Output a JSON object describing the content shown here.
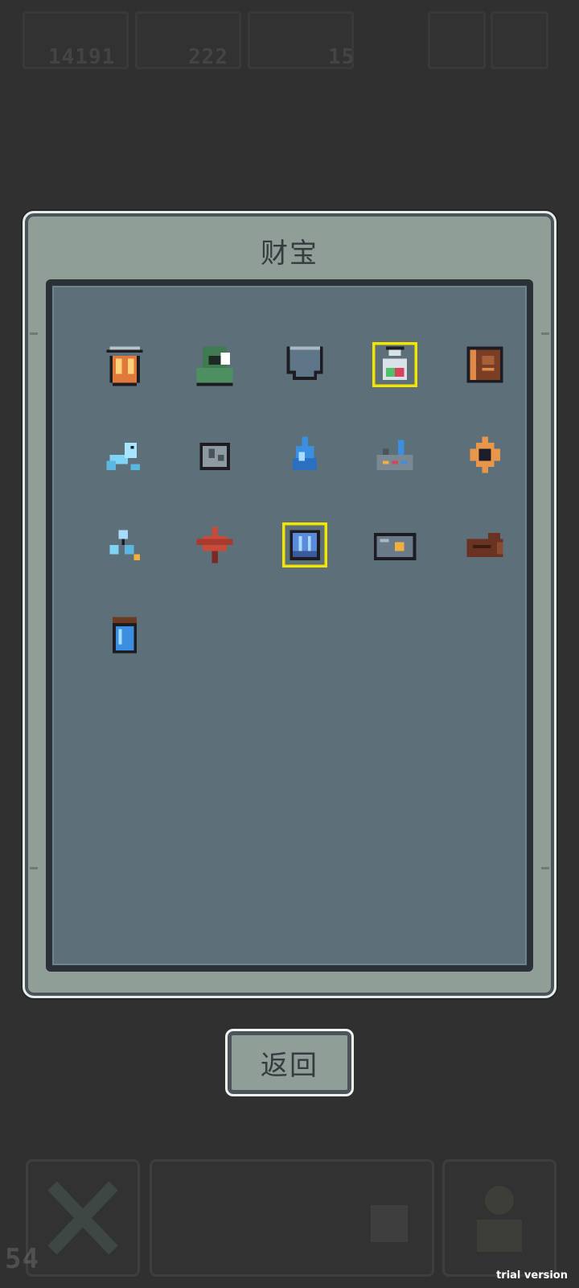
{
  "hud": {
    "currency_1": "14191",
    "currency_2": "222",
    "currency_3": "15",
    "level_readout": "54"
  },
  "panel": {
    "title": "财宝"
  },
  "items": [
    {
      "icon": "lantern-cup-icon"
    },
    {
      "icon": "green-hood-icon"
    },
    {
      "icon": "shield-pocket-icon"
    },
    {
      "icon": "potion-flask-icon"
    },
    {
      "icon": "brown-tome-icon"
    },
    {
      "icon": "ice-dragon-icon"
    },
    {
      "icon": "stone-ore-icon"
    },
    {
      "icon": "water-drop-icon"
    },
    {
      "icon": "factory-icon"
    },
    {
      "icon": "dark-diamond-icon"
    },
    {
      "icon": "blue-molecule-icon"
    },
    {
      "icon": "maple-leaf-icon"
    },
    {
      "icon": "blue-crystal-frame-icon"
    },
    {
      "icon": "camera-box-icon"
    },
    {
      "icon": "wooden-log-icon"
    },
    {
      "icon": "blue-jar-icon"
    }
  ],
  "buttons": {
    "back_label": "返回"
  },
  "watermark": "trial version"
}
